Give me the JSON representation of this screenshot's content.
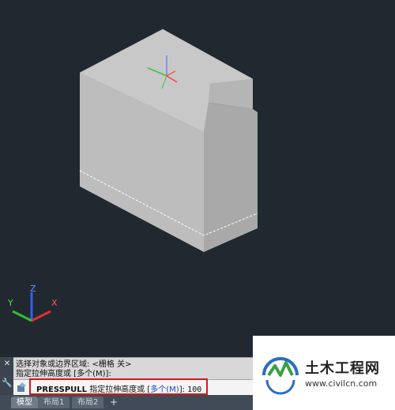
{
  "history": [
    "选择对象或边界区域: <栅格 关>",
    "指定拉伸高度或 [多个(M)]:"
  ],
  "command": {
    "name": "PRESSPULL",
    "prompt": " 指定拉伸高度或 [",
    "option": "多个(M)",
    "prompt_end": "]: ",
    "value": "100"
  },
  "tabs": [
    "模型",
    "布局1",
    "布局2"
  ],
  "tab_add": "+",
  "close_glyph": "✕",
  "wrench_glyph": "🔧",
  "ucs": {
    "x": "X",
    "y": "Y",
    "z": "Z"
  },
  "watermark": {
    "title": "土木工程网",
    "url": "www.civilcn.com"
  },
  "colors": {
    "background": "#212830",
    "solid_top": "#c8c8c8",
    "solid_left": "#bdbdbd",
    "solid_right": "#a9a9a9",
    "highlight": "#d11a1a",
    "axis_x": "#e03030",
    "axis_y": "#30c030",
    "axis_z": "#3060ff"
  }
}
